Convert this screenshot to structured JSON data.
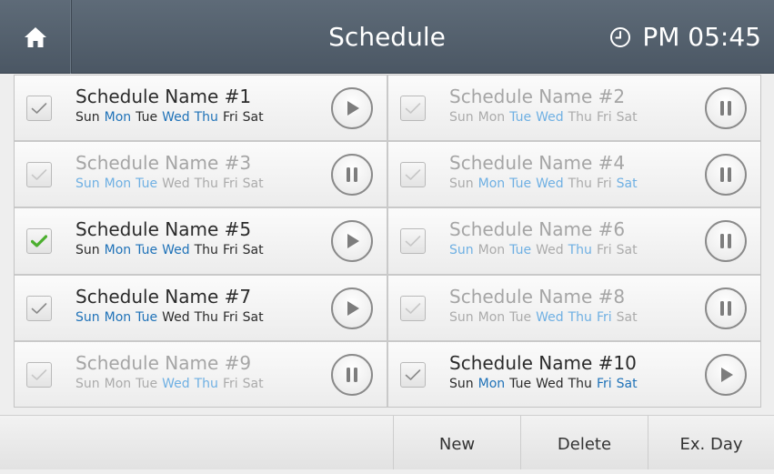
{
  "header": {
    "home_icon": "home-icon",
    "title": "Schedule",
    "clock_icon": "clock-icon",
    "time": "PM 05:45"
  },
  "schedules": [
    {
      "name": "Schedule Name #1",
      "checked": true,
      "state": "play",
      "enabled": true,
      "days": [
        {
          "d": "Sun",
          "on": false
        },
        {
          "d": "Mon",
          "on": true
        },
        {
          "d": "Tue",
          "on": false
        },
        {
          "d": "Wed",
          "on": true
        },
        {
          "d": "Thu",
          "on": true
        },
        {
          "d": "Fri",
          "on": false
        },
        {
          "d": "Sat",
          "on": false
        }
      ]
    },
    {
      "name": "Schedule Name #2",
      "checked": false,
      "state": "pause",
      "enabled": false,
      "days": [
        {
          "d": "Sun",
          "on": false
        },
        {
          "d": "Mon",
          "on": false
        },
        {
          "d": "Tue",
          "on": true
        },
        {
          "d": "Wed",
          "on": true
        },
        {
          "d": "Thu",
          "on": false
        },
        {
          "d": "Fri",
          "on": false
        },
        {
          "d": "Sat",
          "on": false
        }
      ]
    },
    {
      "name": "Schedule Name #3",
      "checked": false,
      "state": "pause",
      "enabled": false,
      "days": [
        {
          "d": "Sun",
          "on": true
        },
        {
          "d": "Mon",
          "on": true
        },
        {
          "d": "Tue",
          "on": true
        },
        {
          "d": "Wed",
          "on": false
        },
        {
          "d": "Thu",
          "on": false
        },
        {
          "d": "Fri",
          "on": false
        },
        {
          "d": "Sat",
          "on": false
        }
      ]
    },
    {
      "name": "Schedule Name #4",
      "checked": false,
      "state": "pause",
      "enabled": false,
      "days": [
        {
          "d": "Sun",
          "on": false
        },
        {
          "d": "Mon",
          "on": true
        },
        {
          "d": "Tue",
          "on": true
        },
        {
          "d": "Wed",
          "on": true
        },
        {
          "d": "Thu",
          "on": false
        },
        {
          "d": "Fri",
          "on": false
        },
        {
          "d": "Sat",
          "on": true
        }
      ]
    },
    {
      "name": "Schedule Name #5",
      "checked": true,
      "state": "play",
      "enabled": true,
      "checkmark_color": "#4caf2f",
      "days": [
        {
          "d": "Sun",
          "on": false
        },
        {
          "d": "Mon",
          "on": true
        },
        {
          "d": "Tue",
          "on": true
        },
        {
          "d": "Wed",
          "on": true
        },
        {
          "d": "Thu",
          "on": false
        },
        {
          "d": "Fri",
          "on": false
        },
        {
          "d": "Sat",
          "on": false
        }
      ]
    },
    {
      "name": "Schedule Name #6",
      "checked": false,
      "state": "pause",
      "enabled": false,
      "days": [
        {
          "d": "Sun",
          "on": true
        },
        {
          "d": "Mon",
          "on": false
        },
        {
          "d": "Tue",
          "on": true
        },
        {
          "d": "Wed",
          "on": false
        },
        {
          "d": "Thu",
          "on": true
        },
        {
          "d": "Fri",
          "on": false
        },
        {
          "d": "Sat",
          "on": false
        }
      ]
    },
    {
      "name": "Schedule Name #7",
      "checked": true,
      "state": "play",
      "enabled": true,
      "days": [
        {
          "d": "Sun",
          "on": true
        },
        {
          "d": "Mon",
          "on": true
        },
        {
          "d": "Tue",
          "on": true
        },
        {
          "d": "Wed",
          "on": false
        },
        {
          "d": "Thu",
          "on": false
        },
        {
          "d": "Fri",
          "on": false
        },
        {
          "d": "Sat",
          "on": false
        }
      ]
    },
    {
      "name": "Schedule Name #8",
      "checked": false,
      "state": "pause",
      "enabled": false,
      "days": [
        {
          "d": "Sun",
          "on": false
        },
        {
          "d": "Mon",
          "on": false
        },
        {
          "d": "Tue",
          "on": false
        },
        {
          "d": "Wed",
          "on": true
        },
        {
          "d": "Thu",
          "on": true
        },
        {
          "d": "Fri",
          "on": true
        },
        {
          "d": "Sat",
          "on": false
        }
      ]
    },
    {
      "name": "Schedule Name #9",
      "checked": false,
      "state": "pause",
      "enabled": false,
      "days": [
        {
          "d": "Sun",
          "on": false
        },
        {
          "d": "Mon",
          "on": false
        },
        {
          "d": "Tue",
          "on": false
        },
        {
          "d": "Wed",
          "on": true
        },
        {
          "d": "Thu",
          "on": true
        },
        {
          "d": "Fri",
          "on": false
        },
        {
          "d": "Sat",
          "on": false
        }
      ]
    },
    {
      "name": "Schedule Name #10",
      "checked": true,
      "state": "play",
      "enabled": true,
      "days": [
        {
          "d": "Sun",
          "on": false
        },
        {
          "d": "Mon",
          "on": true
        },
        {
          "d": "Tue",
          "on": false
        },
        {
          "d": "Wed",
          "on": false
        },
        {
          "d": "Thu",
          "on": false
        },
        {
          "d": "Fri",
          "on": true
        },
        {
          "d": "Sat",
          "on": true
        }
      ]
    }
  ],
  "footer": {
    "new_label": "New",
    "delete_label": "Delete",
    "exday_label": "Ex. Day"
  },
  "colors": {
    "header_bg": "#56626e",
    "day_on": "#1f72b8",
    "day_on_disabled": "#6fb0e3",
    "checkmark_active": "#4caf2f"
  }
}
